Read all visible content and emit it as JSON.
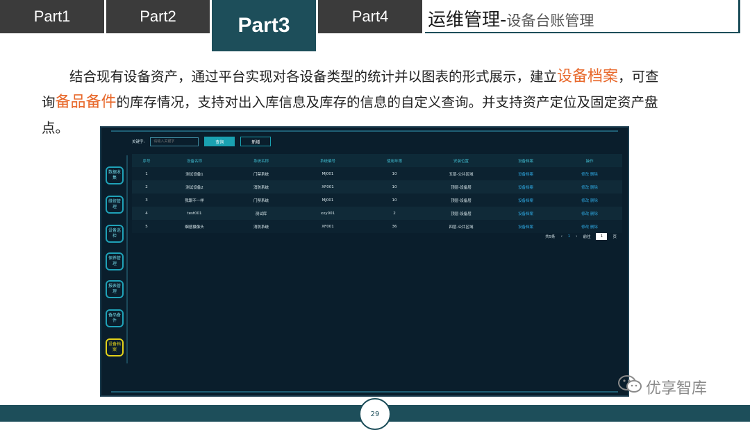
{
  "tabs": [
    {
      "label": "Part1"
    },
    {
      "label": "Part2"
    },
    {
      "label": "Part3",
      "active": true
    },
    {
      "label": "Part4"
    }
  ],
  "header": {
    "title": "运维管理-",
    "subtitle": "设备台账管理"
  },
  "paragraph": {
    "seg1": "结合现有设备资产，通过平台实现对各设备类型的统计并以图表的形式展示，建立",
    "hl1": "设备档案",
    "seg2": "，可查询",
    "hl2": "备品备件",
    "seg3": "的库存情况，支持对出入库信息及库存的信息的自定义查询。并支持资产定位及固定资产盘点。"
  },
  "app": {
    "search": {
      "label": "关键字:",
      "placeholder": "请输入关键字",
      "query_btn": "查询",
      "add_btn": "新增"
    },
    "sidebar": [
      {
        "label": "数据收集"
      },
      {
        "label": "维修管理"
      },
      {
        "label": "设备巡检"
      },
      {
        "label": "保养管理"
      },
      {
        "label": "报表管理"
      },
      {
        "label": "备品备件"
      },
      {
        "label": "设备档案",
        "active": true
      }
    ],
    "table": {
      "headers": [
        "序号",
        "设备名称",
        "系统名称",
        "系统编号",
        "使用年限",
        "安装位置",
        "设备档案",
        "操作"
      ],
      "rows": [
        [
          "1",
          "测试设备1",
          "门禁系统",
          "MJ001",
          "10",
          "五层-公共区域",
          "设备档案",
          "修改",
          "删除"
        ],
        [
          "2",
          "测试设备2",
          "消防系统",
          "XF001",
          "10",
          "顶层-设备层",
          "设备档案",
          "修改",
          "删除"
        ],
        [
          "3",
          "我跟不一样",
          "门禁系统",
          "MJ001",
          "10",
          "顶层-设备层",
          "设备档案",
          "修改",
          "删除"
        ],
        [
          "4",
          "test001",
          "测试库",
          "xxy001",
          "2",
          "顶层-设备层",
          "设备档案",
          "修改",
          "删除"
        ],
        [
          "5",
          "烟感摄像头",
          "消防系统",
          "XF001",
          "36",
          "四层-公共区域",
          "设备档案",
          "修改",
          "删除"
        ]
      ]
    },
    "pager": {
      "total": "共5条",
      "prev": "‹",
      "current": "1",
      "next": "›",
      "goto": "前往",
      "input": "1",
      "unit": "页"
    }
  },
  "footer": {
    "page": "29"
  },
  "watermark": {
    "icon": "wechat-icon",
    "text": "优享智库"
  }
}
